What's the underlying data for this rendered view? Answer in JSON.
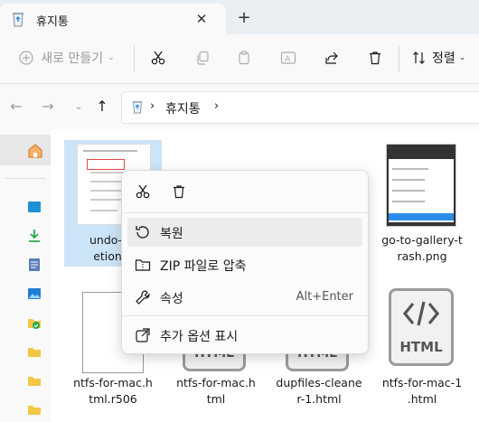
{
  "tab": {
    "title": "휴지통",
    "close": "✕",
    "new": "+"
  },
  "toolbar": {
    "new_label": "새로 만들기",
    "sort_label": "정렬",
    "more": "···"
  },
  "address": {
    "path_label": "휴지통",
    "sep1": "›",
    "sep2": "›"
  },
  "files": [
    {
      "name1": "undo-pn",
      "name2": "etion.p"
    },
    {
      "name1": "go-to-gallery-t",
      "name2": "rash.png"
    },
    {
      "name1": "ntfs-for-mac.h",
      "name2": "tml.r506"
    },
    {
      "name1": "ntfs-for-mac.h",
      "name2": "tml"
    },
    {
      "name1": "dupfiles-cleane",
      "name2": "r-1.html"
    },
    {
      "name1": "ntfs-for-mac-1",
      "name2": ".html"
    }
  ],
  "html_badge": "HTML",
  "context_menu": {
    "items": [
      {
        "label": "복원",
        "icon": "restore-icon"
      },
      {
        "label": "ZIP 파일로 압축",
        "icon": "zip-icon"
      },
      {
        "label": "속성",
        "shortcut": "Alt+Enter",
        "icon": "wrench-icon"
      },
      {
        "label": "추가 옵션 표시",
        "icon": "external-icon"
      }
    ]
  }
}
